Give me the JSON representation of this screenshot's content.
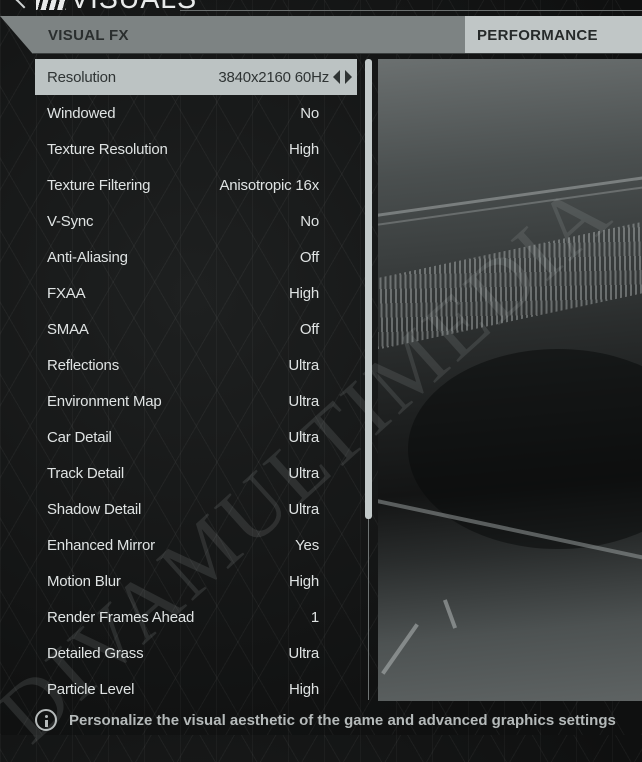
{
  "header": {
    "title": "VISUALS",
    "back_icon": "chevron-left-icon",
    "logo_icon": "game-logo-stripes-icon"
  },
  "tabs": [
    {
      "label": "VISUAL FX",
      "active": true
    },
    {
      "label": "PERFORMANCE",
      "active": false
    }
  ],
  "settings": [
    {
      "label": "Resolution",
      "value": "3840x2160 60Hz",
      "selected": true
    },
    {
      "label": "Windowed",
      "value": "No"
    },
    {
      "label": "Texture Resolution",
      "value": "High"
    },
    {
      "label": "Texture Filtering",
      "value": "Anisotropic 16x"
    },
    {
      "label": "V-Sync",
      "value": "No"
    },
    {
      "label": "Anti-Aliasing",
      "value": "Off"
    },
    {
      "label": "FXAA",
      "value": "High"
    },
    {
      "label": "SMAA",
      "value": "Off"
    },
    {
      "label": "Reflections",
      "value": "Ultra"
    },
    {
      "label": "Environment Map",
      "value": "Ultra"
    },
    {
      "label": "Car Detail",
      "value": "Ultra"
    },
    {
      "label": "Track Detail",
      "value": "Ultra"
    },
    {
      "label": "Shadow Detail",
      "value": "Ultra"
    },
    {
      "label": "Enhanced Mirror",
      "value": "Yes"
    },
    {
      "label": "Motion Blur",
      "value": "High"
    },
    {
      "label": "Render Frames Ahead",
      "value": "1"
    },
    {
      "label": "Detailed Grass",
      "value": "Ultra"
    },
    {
      "label": "Particle Level",
      "value": "High"
    }
  ],
  "footer": {
    "icon": "info-icon",
    "text": "Personalize the visual aesthetic of the game and advanced graphics settings"
  },
  "watermark": "DIVAMULTIMEDIA",
  "colors": {
    "tab_active_bg": "#7d8383",
    "tab_inactive_bg": "#c0c6c6",
    "selected_row_bg": "#bcc3c3",
    "background": "#141515",
    "text": "#dfe3e3"
  }
}
